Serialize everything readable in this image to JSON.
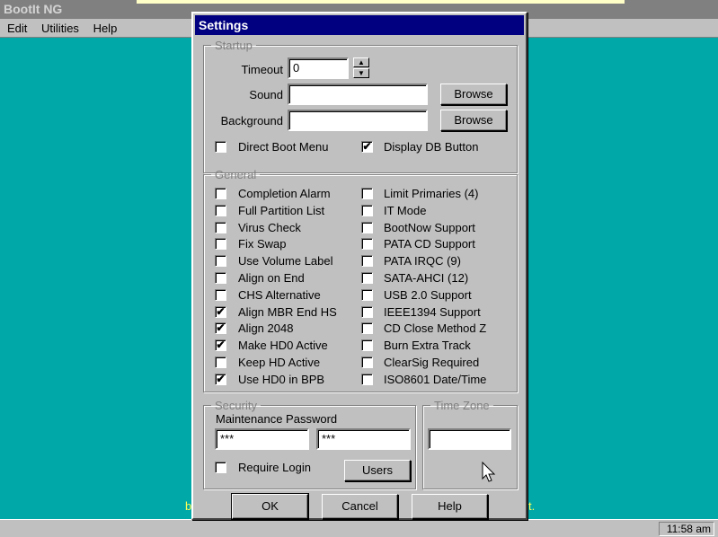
{
  "app": {
    "title": "BootIt NG"
  },
  "menu": [
    {
      "label": "Edit"
    },
    {
      "label": "Utilities"
    },
    {
      "label": "Help"
    }
  ],
  "clock": "11:58 am",
  "background": {
    "left_fragment": "b",
    "right_fragment": "t."
  },
  "dialog": {
    "title": "Settings",
    "startup": {
      "legend": "Startup",
      "timeout_label": "Timeout",
      "timeout_value": "0",
      "sound_label": "Sound",
      "sound_value": "",
      "background_label": "Background",
      "background_value": "",
      "browse_label": "Browse",
      "direct_boot_menu": {
        "label": "Direct Boot Menu",
        "checked": false
      },
      "display_db_button": {
        "label": "Display DB Button",
        "checked": true
      }
    },
    "general": {
      "legend": "General",
      "left": [
        {
          "label": "Completion Alarm",
          "checked": false
        },
        {
          "label": "Full Partition List",
          "checked": false
        },
        {
          "label": "Virus Check",
          "checked": false
        },
        {
          "label": "Fix Swap",
          "checked": false
        },
        {
          "label": "Use Volume Label",
          "checked": false
        },
        {
          "label": "Align on End",
          "checked": false
        },
        {
          "label": "CHS Alternative",
          "checked": false
        },
        {
          "label": "Align MBR End HS",
          "checked": true
        },
        {
          "label": "Align 2048",
          "checked": true
        },
        {
          "label": "Make HD0 Active",
          "checked": true
        },
        {
          "label": "Keep HD Active",
          "checked": false
        },
        {
          "label": "Use HD0 in BPB",
          "checked": true
        }
      ],
      "right": [
        {
          "label": "Limit Primaries (4)",
          "checked": false
        },
        {
          "label": "IT Mode",
          "checked": false
        },
        {
          "label": "BootNow Support",
          "checked": false
        },
        {
          "label": "PATA CD Support",
          "checked": false
        },
        {
          "label": "PATA IRQC (9)",
          "checked": false
        },
        {
          "label": "SATA-AHCI (12)",
          "checked": false
        },
        {
          "label": "USB 2.0 Support",
          "checked": false
        },
        {
          "label": "IEEE1394 Support",
          "checked": false
        },
        {
          "label": "CD Close Method Z",
          "checked": false
        },
        {
          "label": "Burn Extra Track",
          "checked": false
        },
        {
          "label": "ClearSig Required",
          "checked": false
        },
        {
          "label": "ISO8601 Date/Time",
          "checked": false
        }
      ]
    },
    "security": {
      "legend": "Security",
      "password_label": "Maintenance Password",
      "password1": "***",
      "password2": "***",
      "require_login": {
        "label": "Require Login",
        "checked": false
      },
      "users_label": "Users"
    },
    "timezone": {
      "legend": "Time Zone",
      "value": ""
    },
    "buttons": {
      "ok": "OK",
      "cancel": "Cancel",
      "help": "Help"
    }
  }
}
